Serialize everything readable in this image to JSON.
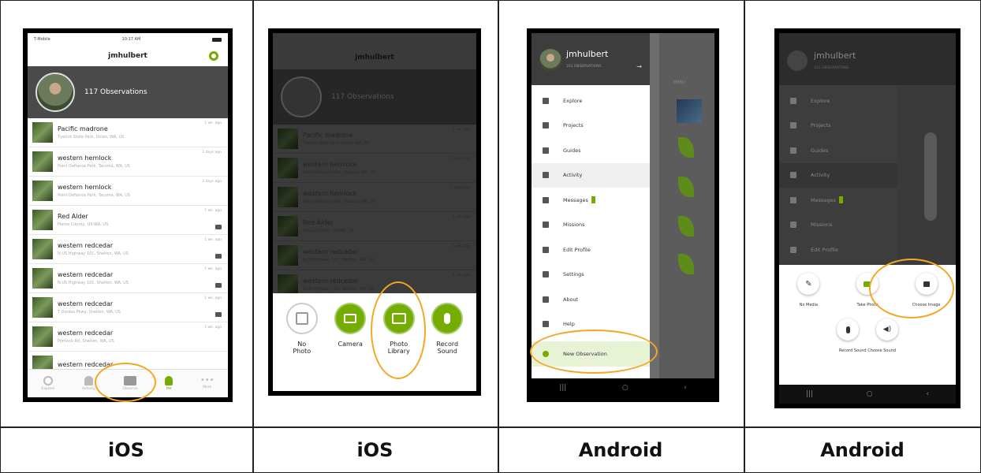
{
  "captions": [
    "iOS",
    "iOS",
    "Android",
    "Android"
  ],
  "accent_color": "#74ac00",
  "highlight_color": "#f5a623",
  "ios_profile": {
    "carrier": "T-Mobile",
    "time": "10:17 AM",
    "username": "jmhulbert",
    "observations_label": "117 Observations",
    "items": [
      {
        "name": "Pacific madrone",
        "place": "Tverick State Park, Union, WA, US",
        "time": "1 wk. ago",
        "comment": false
      },
      {
        "name": "western hemlock",
        "place": "Point Defiance Park, Tacoma, WA, US",
        "time": "2 days ago",
        "comment": false
      },
      {
        "name": "western hemlock",
        "place": "Point Defiance Park, Tacoma, WA, US",
        "time": "2 days ago",
        "comment": false
      },
      {
        "name": "Red Alder",
        "place": "Pierce County, US-WA, US",
        "time": "1 wk. ago",
        "comment": true
      },
      {
        "name": "western redcedar",
        "place": "N US Highway 101, Shelton, WA, US",
        "time": "1 wk. ago",
        "comment": true
      },
      {
        "name": "western redcedar",
        "place": "N US Highway 101, Shelton, WA, US",
        "time": "1 wk. ago",
        "comment": true
      },
      {
        "name": "western redcedar",
        "place": "T Dsrdes Pkwy, Shelton, WA, US",
        "time": "1 wk. ago",
        "comment": true
      },
      {
        "name": "western redcedar",
        "place": "Portlock Rd, Shelton, WA, US",
        "time": "1 wk. ago",
        "comment": false
      },
      {
        "name": "western redcedar",
        "place": "",
        "time": "",
        "comment": false
      }
    ],
    "tabs": [
      "Explore",
      "Activity",
      "Observe",
      "Me",
      "More"
    ]
  },
  "ios_sheet": {
    "options": [
      "No Photo",
      "Camera",
      "Photo Library",
      "Record Sound"
    ]
  },
  "android_drawer": {
    "username": "jmhulbert",
    "observations_label": "331 OBSERVATIONS",
    "menu_label": "MENU",
    "items": [
      "Explore",
      "Projects",
      "Guides",
      "Activity",
      "Messages",
      "Missions",
      "Edit Profile",
      "Settings",
      "About",
      "Help",
      "New Observation"
    ]
  },
  "android_sheet": {
    "username": "jmhulbert",
    "observations_label": "331 OBSERVATIONS",
    "options_row1": [
      "No Media",
      "Take Photo",
      "Choose Image"
    ],
    "options_row2_label": "Record Sound  Choose Sound"
  }
}
